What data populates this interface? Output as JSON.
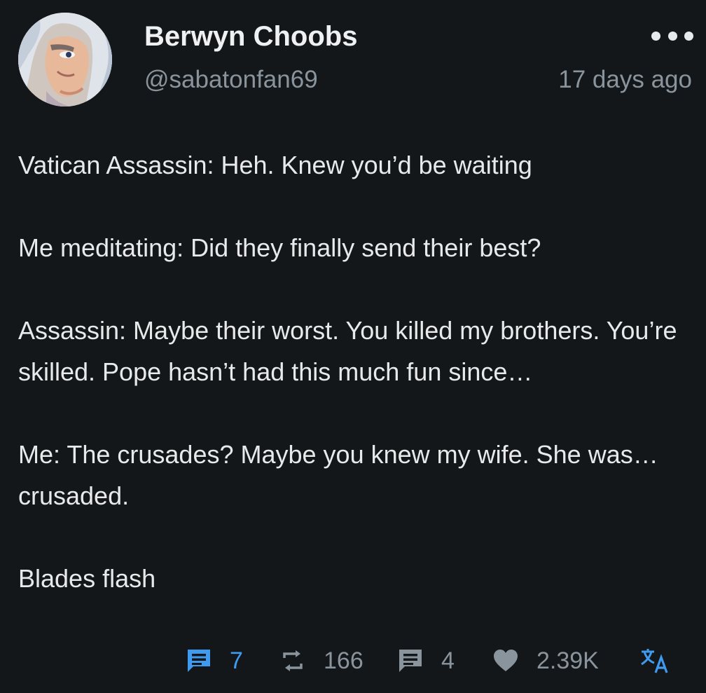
{
  "author": {
    "display_name": "Berwyn Choobs",
    "handle": "@sabatonfan69"
  },
  "post": {
    "timestamp": "17 days ago",
    "paragraphs": [
      "Vatican Assassin: Heh. Knew you’d be waiting",
      "Me meditating: Did they finally send their best?",
      "Assassin: Maybe their worst. You killed my brothers. You’re skilled. Pope hasn’t had this much fun since…",
      "Me: The crusades? Maybe you knew my wife. She was… crusaded.",
      "Blades flash"
    ]
  },
  "actions": {
    "comments": "7",
    "reposts": "166",
    "quotes": "4",
    "likes": "2.39K"
  },
  "icons": {
    "more": "more-dots-icon",
    "comments": "comment-icon",
    "reposts": "repost-icon",
    "quotes": "quote-icon",
    "likes": "heart-icon",
    "translate": "translate-icon"
  },
  "colors": {
    "background": "#14171a",
    "text": "#e7e9ea",
    "muted": "#8a949d",
    "accent": "#3f9bf0"
  }
}
